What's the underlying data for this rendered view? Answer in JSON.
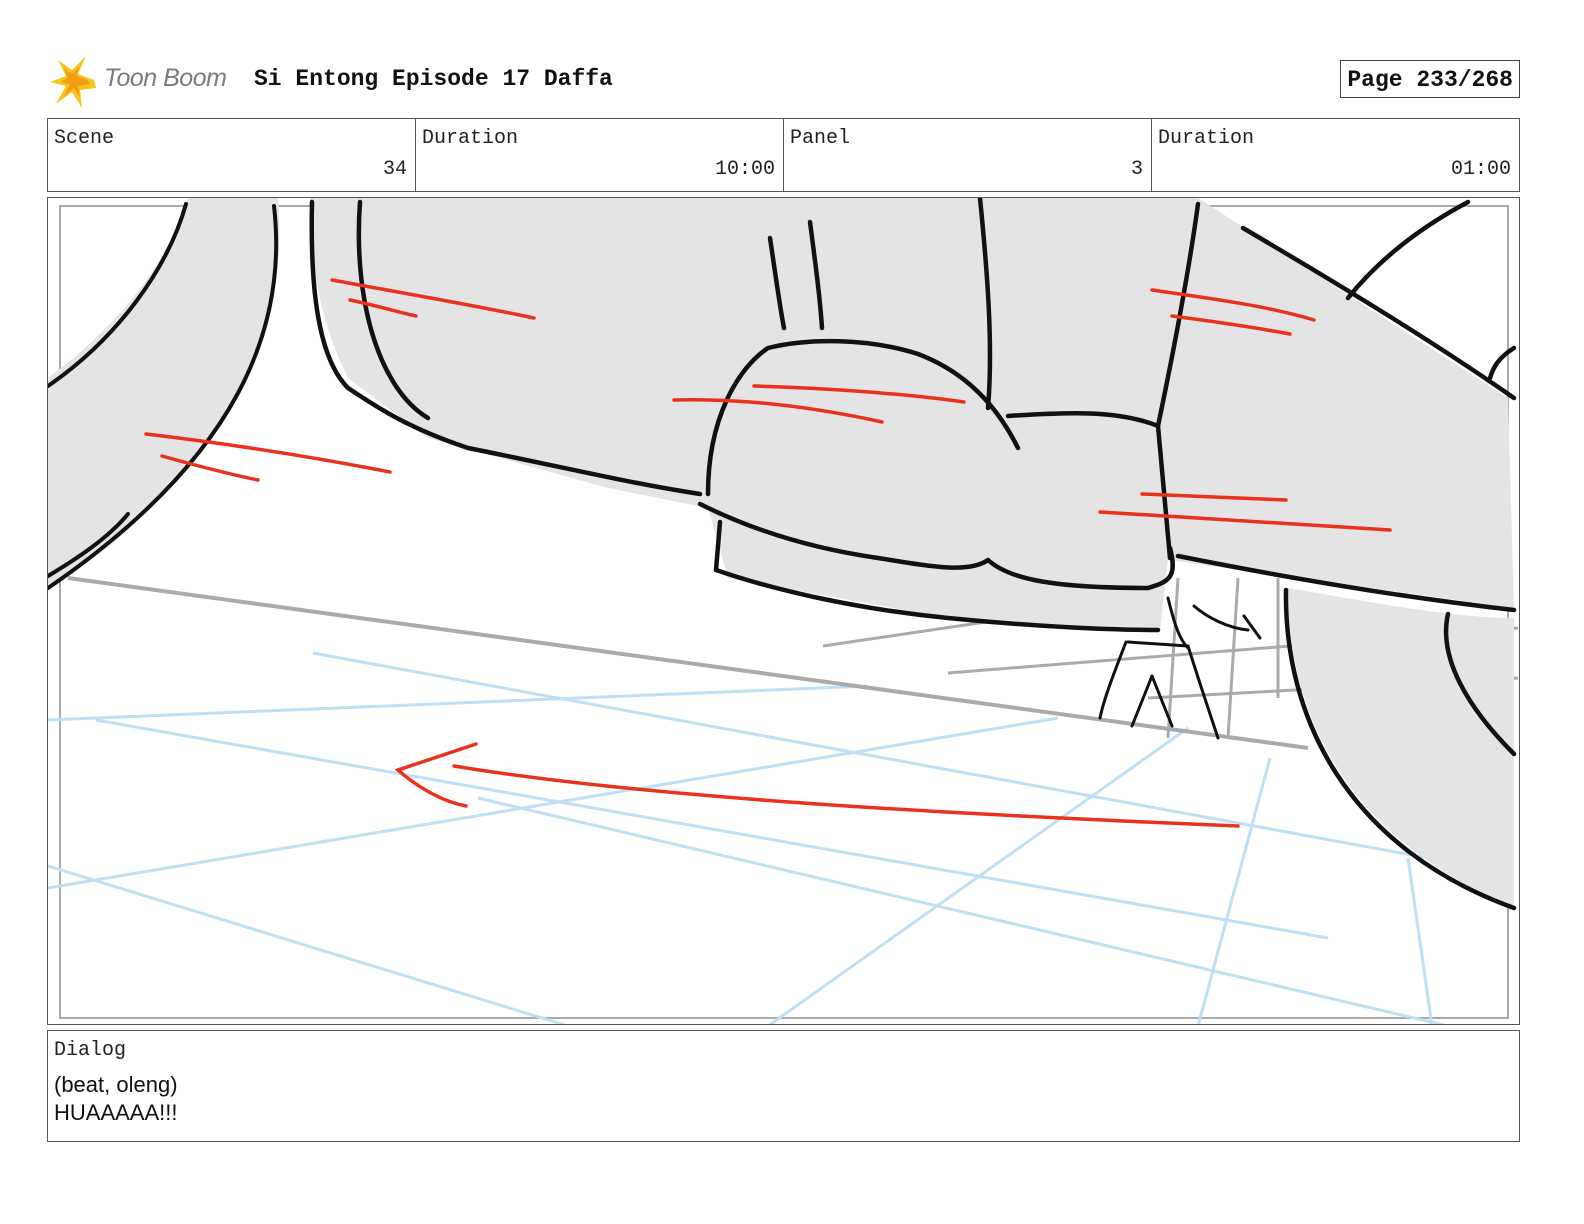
{
  "header": {
    "logo_text": "Toon Boom",
    "project_title": "Si Entong Episode 17 Daffa",
    "page_label": "Page 233/268"
  },
  "info": {
    "scene_label": "Scene",
    "scene_value": "34",
    "scene_duration_label": "Duration",
    "scene_duration_value": "10:00",
    "panel_label": "Panel",
    "panel_value": "3",
    "panel_duration_label": "Duration",
    "panel_duration_value": "01:00"
  },
  "dialog": {
    "label": "Dialog",
    "lines": [
      "(beat, oleng)",
      "HUAAAAA!!!"
    ]
  },
  "colors": {
    "sketch_fill": "#e4e4e4",
    "ink": "#111111",
    "motion_lines": "#e8321c",
    "floor_grid": "#bfe0f4",
    "logo_star": "#f7c61a"
  },
  "icons": {
    "logo": "toon-boom-star-icon"
  }
}
